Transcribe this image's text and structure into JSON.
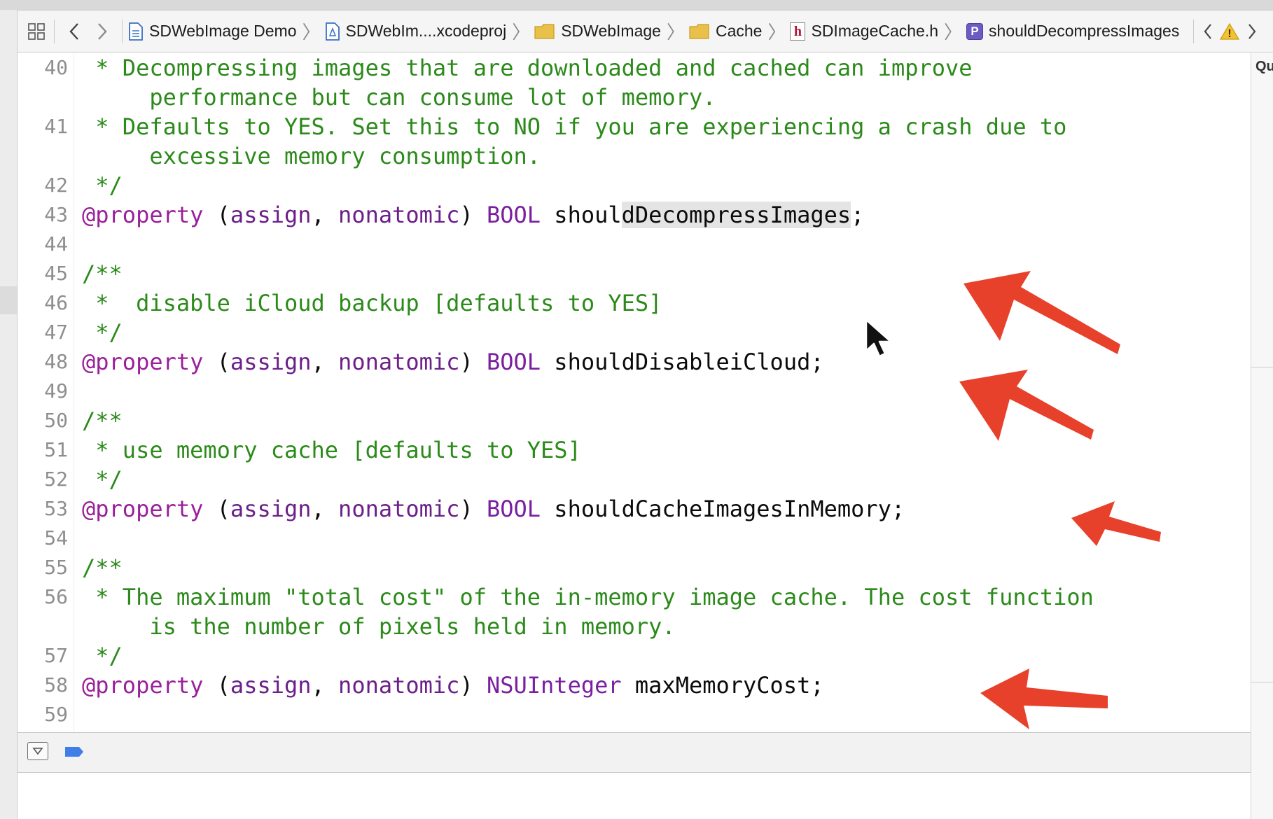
{
  "jumpbar": {
    "crumbs": [
      {
        "label": "SDWebImage Demo",
        "icon": "document-icon"
      },
      {
        "label": "SDWebIm....xcodeproj",
        "icon": "xcodeproj-icon"
      },
      {
        "label": "SDWebImage",
        "icon": "folder-icon"
      },
      {
        "label": "Cache",
        "icon": "folder-icon"
      },
      {
        "label": "SDImageCache.h",
        "icon": "header-file-icon",
        "icon_glyph": "h"
      },
      {
        "label": "shouldDecompressImages",
        "icon": "property-icon",
        "icon_glyph": "P"
      }
    ],
    "warning_glyph": "!"
  },
  "editor": {
    "lines": [
      {
        "num": "40",
        "text": " * Decompressing images that are downloaded and cached can improve"
      },
      {
        "num": "",
        "text": "     performance but can consume lot of memory."
      },
      {
        "num": "41",
        "text": " * Defaults to YES. Set this to NO if you are experiencing a crash due to"
      },
      {
        "num": "",
        "text": "     excessive memory consumption."
      },
      {
        "num": "42",
        "text": " */"
      },
      {
        "num": "43",
        "kw": "@property",
        "attrs": "assign",
        "attrs2": "nonatomic",
        "type": "BOOL",
        "ident_pre": "shoul",
        "ident_hl": "dDecompressImages",
        "ident_post": ";"
      },
      {
        "num": "44",
        "text": ""
      },
      {
        "num": "45",
        "text": "/**"
      },
      {
        "num": "46",
        "text": " *  disable iCloud backup [defaults to YES]"
      },
      {
        "num": "47",
        "text": " */"
      },
      {
        "num": "48",
        "kw": "@property",
        "attrs": "assign",
        "attrs2": "nonatomic",
        "type": "BOOL",
        "ident_pre": "shouldDisableiCloud",
        "ident_hl": "",
        "ident_post": ";"
      },
      {
        "num": "49",
        "text": ""
      },
      {
        "num": "50",
        "text": "/**"
      },
      {
        "num": "51",
        "text": " * use memory cache [defaults to YES]"
      },
      {
        "num": "52",
        "text": " */"
      },
      {
        "num": "53",
        "kw": "@property",
        "attrs": "assign",
        "attrs2": "nonatomic",
        "type": "BOOL",
        "ident_pre": "shouldCacheImagesInMemory",
        "ident_hl": "",
        "ident_post": ";"
      },
      {
        "num": "54",
        "text": ""
      },
      {
        "num": "55",
        "text": "/**"
      },
      {
        "num": "56",
        "text": " * The maximum \"total cost\" of the in-memory image cache. The cost function"
      },
      {
        "num": "",
        "text": "     is the number of pixels held in memory."
      },
      {
        "num": "57",
        "text": " */"
      },
      {
        "num": "58",
        "kw": "@property",
        "attrs": "assign",
        "attrs2": "nonatomic",
        "type": "NSUInteger",
        "ident_pre": "maxMemoryCost",
        "ident_hl": "",
        "ident_post": ";"
      },
      {
        "num": "59",
        "text": ""
      }
    ]
  },
  "right_column": {
    "glyph": "Qu"
  },
  "colors": {
    "comment": "#2b8a1a",
    "keyword": "#9a1f9a",
    "arrow": "#e8412b",
    "breakpoint": "#3f7ee8"
  }
}
